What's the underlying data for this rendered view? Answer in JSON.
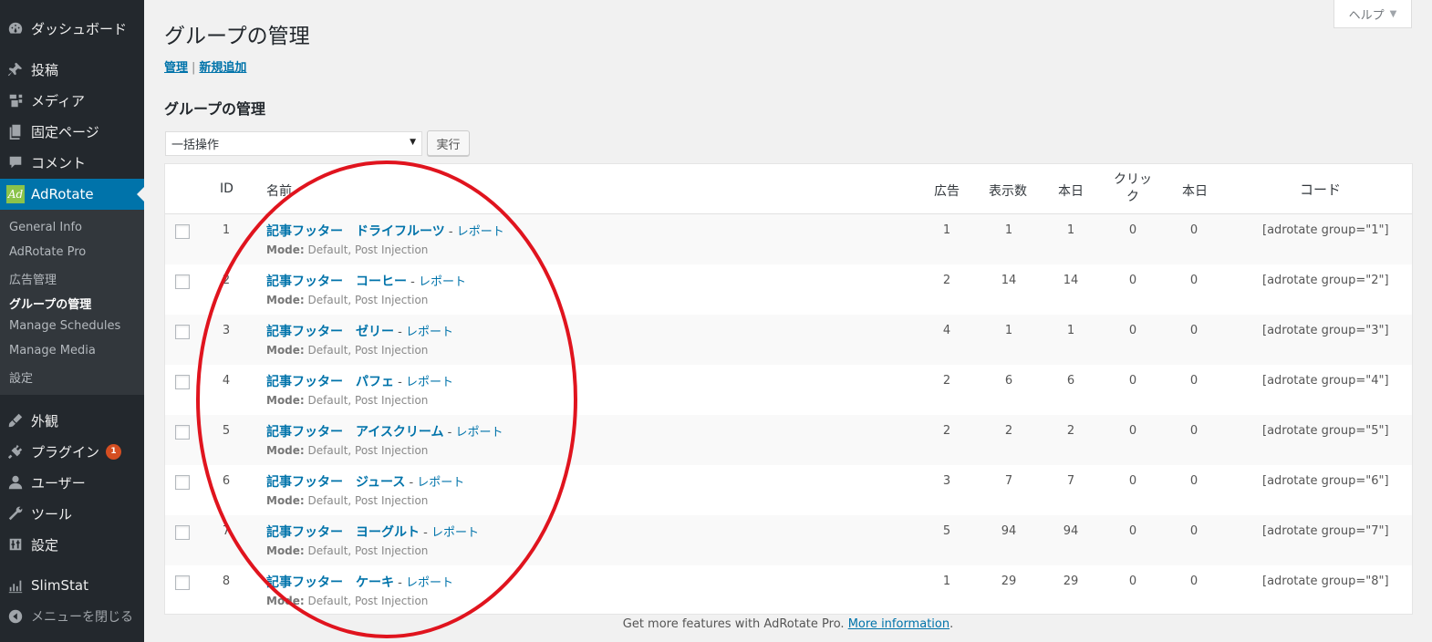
{
  "sidebar": {
    "items": [
      {
        "label": "ダッシュボード",
        "icon": "dashboard-icon"
      },
      {
        "label": "投稿",
        "icon": "pin-icon"
      },
      {
        "label": "メディア",
        "icon": "media-icon"
      },
      {
        "label": "固定ページ",
        "icon": "pages-icon"
      },
      {
        "label": "コメント",
        "icon": "comment-icon"
      },
      {
        "label": "AdRotate",
        "icon": "adrotate-icon",
        "icon_text": "Ad"
      },
      {
        "label": "外観",
        "icon": "brush-icon"
      },
      {
        "label": "プラグイン",
        "icon": "plugin-icon",
        "badge": "1"
      },
      {
        "label": "ユーザー",
        "icon": "user-icon"
      },
      {
        "label": "ツール",
        "icon": "wrench-icon"
      },
      {
        "label": "設定",
        "icon": "settings-icon"
      },
      {
        "label": "SlimStat",
        "icon": "chart-icon"
      },
      {
        "label": "メニューを閉じる",
        "icon": "collapse-icon"
      }
    ],
    "submenu": [
      "General Info",
      "AdRotate Pro",
      "広告管理",
      "グループの管理",
      "Manage Schedules",
      "Manage Media",
      "設定"
    ]
  },
  "help_tab": {
    "label": "ヘルプ",
    "arrow": "▼"
  },
  "page": {
    "title": "グループの管理",
    "subnav": {
      "manage": "管理",
      "sep": "|",
      "add_new": "新規追加"
    },
    "section_title": "グループの管理",
    "bulk_action": {
      "selected": "一括操作"
    },
    "apply_label": "実行"
  },
  "table": {
    "headers": {
      "id": "ID",
      "name": "名前",
      "ads": "広告",
      "impressions": "表示数",
      "today1": "本日",
      "clicks": "クリック",
      "today2": "本日",
      "code": "コード"
    },
    "report_label": "レポート",
    "mode_label": "Mode:",
    "mode_value": "Default, Post Injection",
    "rows": [
      {
        "id": "1",
        "name": "記事フッター　ドライフルーツ",
        "ads": "1",
        "impressions": "1",
        "today1": "1",
        "clicks": "0",
        "today2": "0",
        "code": "[adrotate group=\"1\"]"
      },
      {
        "id": "2",
        "name": "記事フッター　コーヒー",
        "ads": "2",
        "impressions": "14",
        "today1": "14",
        "clicks": "0",
        "today2": "0",
        "code": "[adrotate group=\"2\"]"
      },
      {
        "id": "3",
        "name": "記事フッター　ゼリー",
        "ads": "4",
        "impressions": "1",
        "today1": "1",
        "clicks": "0",
        "today2": "0",
        "code": "[adrotate group=\"3\"]"
      },
      {
        "id": "4",
        "name": "記事フッター　パフェ",
        "ads": "2",
        "impressions": "6",
        "today1": "6",
        "clicks": "0",
        "today2": "0",
        "code": "[adrotate group=\"4\"]"
      },
      {
        "id": "5",
        "name": "記事フッター　アイスクリーム",
        "ads": "2",
        "impressions": "2",
        "today1": "2",
        "clicks": "0",
        "today2": "0",
        "code": "[adrotate group=\"5\"]"
      },
      {
        "id": "6",
        "name": "記事フッター　ジュース",
        "ads": "3",
        "impressions": "7",
        "today1": "7",
        "clicks": "0",
        "today2": "0",
        "code": "[adrotate group=\"6\"]"
      },
      {
        "id": "7",
        "name": "記事フッター　ヨーグルト",
        "ads": "5",
        "impressions": "94",
        "today1": "94",
        "clicks": "0",
        "today2": "0",
        "code": "[adrotate group=\"7\"]"
      },
      {
        "id": "8",
        "name": "記事フッター　ケーキ",
        "ads": "1",
        "impressions": "29",
        "today1": "29",
        "clicks": "0",
        "today2": "0",
        "code": "[adrotate group=\"8\"]"
      }
    ]
  },
  "footer": {
    "text": "Get more features with AdRotate Pro.",
    "link": "More information",
    "suffix": "."
  },
  "colors": {
    "sidebar_bg": "#23282d",
    "active_bg": "#0073aa",
    "link": "#0073aa",
    "annotation": "#e0141e",
    "badge": "#d54e21"
  }
}
